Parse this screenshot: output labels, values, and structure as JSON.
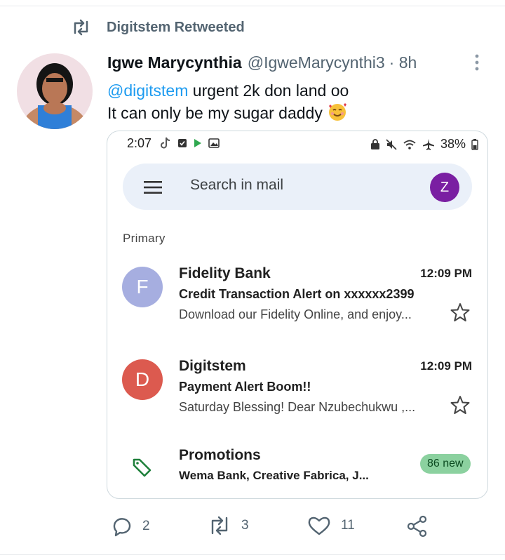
{
  "retweet": {
    "text": "Digitstem Retweeted"
  },
  "tweet": {
    "author_name": "Igwe Marycynthia",
    "handle": "@IgweMarycynthi3",
    "time": "· 8h",
    "mention": "@digitstem",
    "line1_rest": " urgent 2k don land oo",
    "line2": "It can only be my sugar daddy"
  },
  "phone": {
    "status_time": "2:07",
    "battery": "38%",
    "search_placeholder": "Search in mail",
    "profile_initial": "Z",
    "section_label": "Primary",
    "emails": [
      {
        "initial": "F",
        "avatar_color": "#a6aee0",
        "sender": "Fidelity Bank",
        "time": "12:09 PM",
        "subject": "Credit Transaction Alert on xxxxxx2399",
        "snippet": "Download our Fidelity Online, and enjoy..."
      },
      {
        "initial": "D",
        "avatar_color": "#dc5a4f",
        "sender": "Digitstem",
        "time": "12:09 PM",
        "subject": "Payment Alert Boom!!",
        "snippet": "Saturday Blessing! Dear Nzubechukwu ,..."
      }
    ],
    "promotions": {
      "label": "Promotions",
      "desc": "Wema Bank, Creative Fabrica, J...",
      "badge": "86 new"
    }
  },
  "actions": {
    "replies": "2",
    "retweets": "3",
    "likes": "11"
  },
  "colors": {
    "link": "#1d9bf0",
    "muted": "#536471",
    "promo_badge": "#8bd19f",
    "profile": "#7a1fa2"
  }
}
